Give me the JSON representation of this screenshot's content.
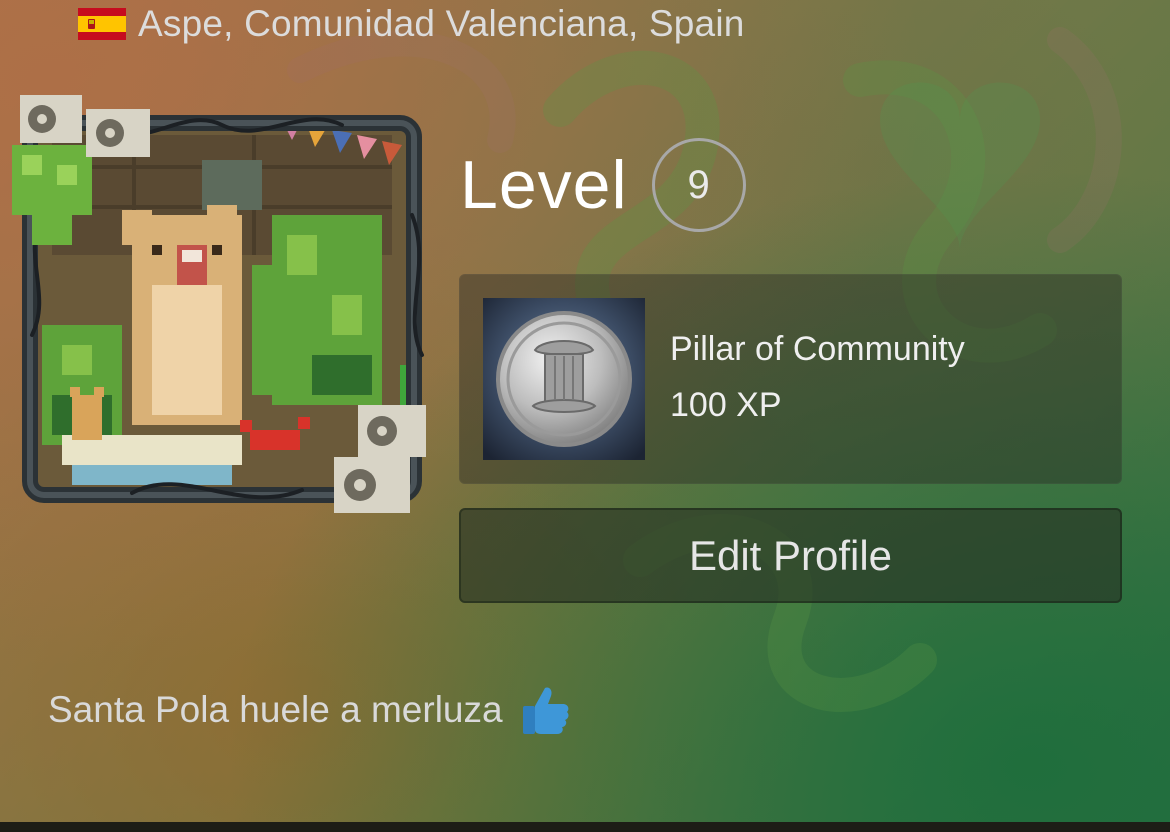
{
  "profile": {
    "location": "Aspe, Comunidad Valenciana, Spain",
    "flag_icon": "spain-flag-icon",
    "level_label": "Level",
    "level_value": "9",
    "summary": "Santa Pola huele a merluza",
    "summary_emoji": "thumbs-up-icon"
  },
  "badge": {
    "name": "Pillar of Community",
    "xp": "100 XP",
    "icon": "pillar-coin-icon"
  },
  "actions": {
    "edit_profile": "Edit Profile"
  },
  "colors": {
    "level_ring": "#a8a8a8",
    "thumb_blue": "#3e97d8",
    "flag_red": "#c60b1e",
    "flag_yellow": "#ffc400"
  }
}
